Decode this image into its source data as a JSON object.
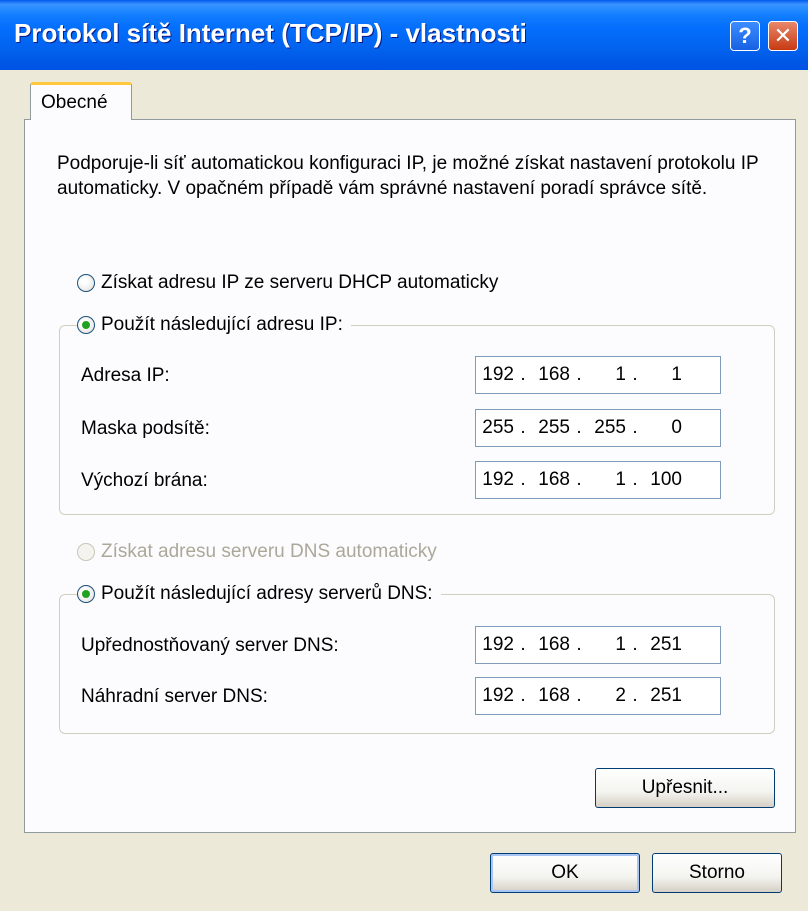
{
  "window": {
    "title": "Protokol sítě Internet (TCP/IP) - vlastnosti",
    "help_label": "?",
    "close_label": "✕"
  },
  "tabs": [
    {
      "label": "Obecné",
      "active": true
    }
  ],
  "intro_text": "Podporuje-li síť automatickou konfiguraci IP, je možné získat nastavení protokolu IP automaticky. V opačném případě vám správné nastavení poradí správce sítě.",
  "ip_mode": {
    "auto_label": "Získat adresu IP ze serveru DHCP automaticky",
    "manual_label": "Použít následující adresu IP:",
    "selected": "manual"
  },
  "ip_fields": [
    {
      "label": "Adresa IP:",
      "octets": [
        "192",
        "168",
        "1",
        "1"
      ]
    },
    {
      "label": "Maska podsítě:",
      "octets": [
        "255",
        "255",
        "255",
        "0"
      ]
    },
    {
      "label": "Výchozí brána:",
      "octets": [
        "192",
        "168",
        "1",
        "100"
      ]
    }
  ],
  "dns_mode": {
    "auto_label": "Získat adresu serveru DNS automaticky",
    "auto_disabled": true,
    "manual_label": "Použít následující adresy serverů DNS:",
    "selected": "manual"
  },
  "dns_fields": [
    {
      "label": "Upřednostňovaný server DNS:",
      "octets": [
        "192",
        "168",
        "1",
        "251"
      ]
    },
    {
      "label": "Náhradní server DNS:",
      "octets": [
        "192",
        "168",
        "2",
        "251"
      ]
    }
  ],
  "buttons": {
    "advanced": "Upřesnit...",
    "ok": "OK",
    "cancel": "Storno"
  },
  "colors": {
    "titlebar": "#0054E3",
    "dialog_bg": "#ECE9D8",
    "tab_accent": "#FFC83C",
    "radio_dot": "#21A121"
  }
}
